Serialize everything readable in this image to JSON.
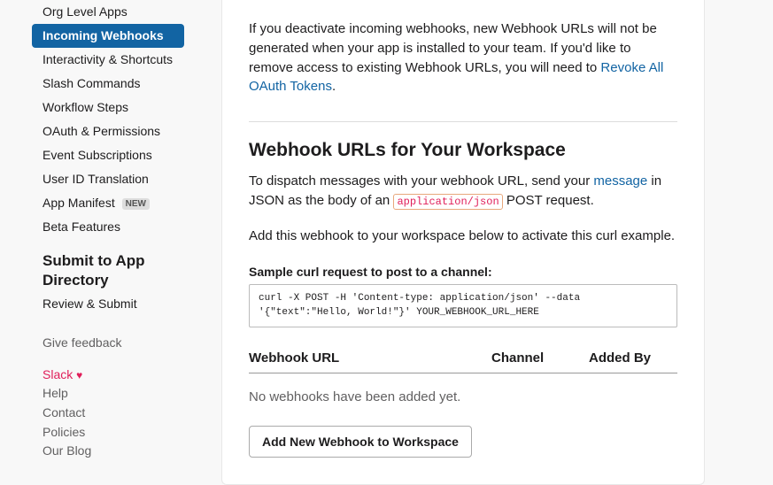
{
  "sidebar": {
    "nav": [
      {
        "label": "Org Level Apps"
      },
      {
        "label": "Incoming Webhooks",
        "active": true
      },
      {
        "label": "Interactivity & Shortcuts"
      },
      {
        "label": "Slash Commands"
      },
      {
        "label": "Workflow Steps"
      },
      {
        "label": "OAuth & Permissions"
      },
      {
        "label": "Event Subscriptions"
      },
      {
        "label": "User ID Translation"
      },
      {
        "label": "App Manifest",
        "badge": "NEW"
      },
      {
        "label": "Beta Features"
      }
    ],
    "submit_section_title": "Submit to App Directory",
    "review_submit": "Review & Submit",
    "feedback": "Give feedback",
    "footer": {
      "brand": "Slack",
      "heart": "♥",
      "help": "Help",
      "contact": "Contact",
      "policies": "Policies",
      "blog": "Our Blog"
    }
  },
  "content": {
    "deactivate_text_1": "If you deactivate incoming webhooks, new Webhook URLs will not be generated when your app is installed to your team. If you'd like to remove access to existing Webhook URLs, you will need to ",
    "revoke_link": "Revoke All OAuth Tokens",
    "period": ".",
    "section_title": "Webhook URLs for Your Workspace",
    "dispatch_1": "To dispatch messages with your webhook URL, send your ",
    "message_link": "message",
    "dispatch_2": " in JSON as the body of an ",
    "code_inline": "application/json",
    "dispatch_3": " POST request.",
    "add_webhook_text": "Add this webhook to your workspace below to activate this curl example.",
    "sample_label": "Sample curl request to post to a channel:",
    "sample_code": "curl -X POST -H 'Content-type: application/json' --data '{\"text\":\"Hello, World!\"}' YOUR_WEBHOOK_URL_HERE",
    "table": {
      "col_url": "Webhook URL",
      "col_channel": "Channel",
      "col_added": "Added By"
    },
    "empty_text": "No webhooks have been added yet.",
    "add_button": "Add New Webhook to Workspace"
  }
}
